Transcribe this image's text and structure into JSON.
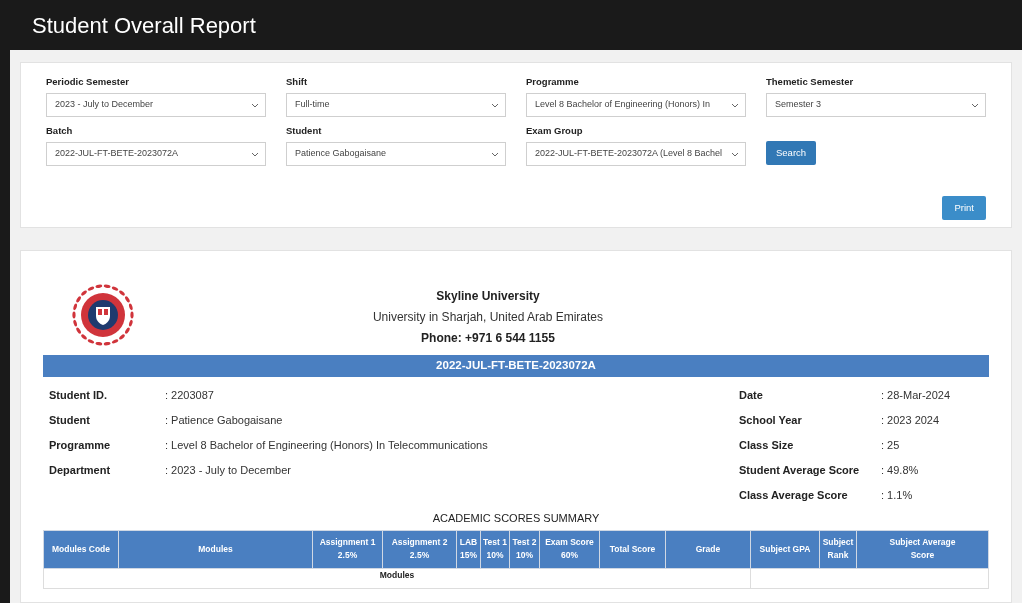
{
  "header": {
    "title": "Student Overall Report"
  },
  "filters": [
    {
      "label": "Periodic Semester",
      "value": "2023 - July to December"
    },
    {
      "label": "Shift",
      "value": "Full-time"
    },
    {
      "label": "Programme",
      "value": "Level 8 Bachelor of Engineering (Honors) In"
    },
    {
      "label": "Themetic Semester",
      "value": "Semester 3"
    },
    {
      "label": "Batch",
      "value": "2022-JUL-FT-BETE-2023072A"
    },
    {
      "label": "Student",
      "value": "Patience Gabogaisane"
    },
    {
      "label": "Exam Group",
      "value": "2022-JUL-FT-BETE-2023072A (Level 8 Bachel"
    }
  ],
  "search_button": "Search",
  "print_button": "Print",
  "report": {
    "university": "Skyline University",
    "location": "University in Sharjah, United Arab Emirates",
    "phone": "Phone: +971 6 544 1155",
    "batch_banner": "2022-JUL-FT-BETE-2023072A",
    "left_fields": [
      {
        "label": "Student ID.",
        "value": ": 2203087"
      },
      {
        "label": "Student",
        "value": ": Patience Gabogaisane"
      },
      {
        "label": "Programme",
        "value": ": Level 8 Bachelor of Engineering (Honors) In Telecommunications"
      },
      {
        "label": "Department",
        "value": ": 2023 - July to December"
      }
    ],
    "right_fields": [
      {
        "label": "Date",
        "value": ": 28-Mar-2024"
      },
      {
        "label": "School Year",
        "value": ": 2023 2024"
      },
      {
        "label": "Class Size",
        "value": ": 25"
      },
      {
        "label": "Student Average Score",
        "value": ": 49.8%"
      },
      {
        "label": "Class Average Score",
        "value": ": 1.1%"
      }
    ],
    "summary_title": "ACADEMIC SCORES SUMMARY",
    "columns": [
      {
        "label": "Modules Code"
      },
      {
        "label": "Modules"
      },
      {
        "label": "Assignment 1",
        "sub": "2.5%"
      },
      {
        "label": "Assignment 2",
        "sub": "2.5%"
      },
      {
        "label": "LAB",
        "sub": "15%"
      },
      {
        "label": "Test 1",
        "sub": "10%"
      },
      {
        "label": "Test 2",
        "sub": "10%"
      },
      {
        "label": "Exam Score",
        "sub": "60%"
      },
      {
        "label": "Total Score"
      },
      {
        "label": "Grade"
      },
      {
        "label": "Subject GPA"
      },
      {
        "label": "Subject",
        "sub": "Rank"
      },
      {
        "label": "Subject Average",
        "sub": "Score"
      }
    ],
    "group_row": "Modules"
  }
}
